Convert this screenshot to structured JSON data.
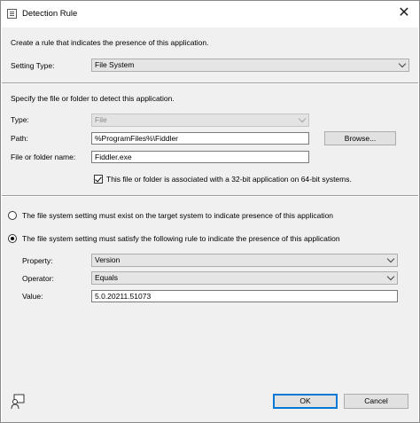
{
  "window": {
    "title": "Detection Rule",
    "close_glyph": "✕",
    "title_icon": "dialog-window-icon"
  },
  "intro": {
    "description": "Create a rule that indicates the presence of this application.",
    "setting_type_label": "Setting Type:",
    "setting_type_value": "File System"
  },
  "file_section": {
    "description": "Specify the file or folder to detect this application.",
    "type_label": "Type:",
    "type_value": "File",
    "path_label": "Path:",
    "path_value": "%ProgramFiles%\\Fiddler",
    "browse_label": "Browse...",
    "name_label": "File or folder name:",
    "name_value": "Fiddler.exe",
    "bitness_checkbox_label": "This file or folder is associated with a 32-bit application on 64-bit systems.",
    "bitness_checked": true
  },
  "rule_options": {
    "exist_label": "The file system setting must exist on the target system to indicate presence of this application",
    "exist_selected": false,
    "satisfy_label": "The file system setting must satisfy the following rule to indicate the presence of this application",
    "satisfy_selected": true,
    "property_label": "Property:",
    "property_value": "Version",
    "operator_label": "Operator:",
    "operator_value": "Equals",
    "value_label": "Value:",
    "value_value": "5.0.20211.51073"
  },
  "footer": {
    "ok_label": "OK",
    "cancel_label": "Cancel",
    "help_icon": "help-person-icon"
  }
}
